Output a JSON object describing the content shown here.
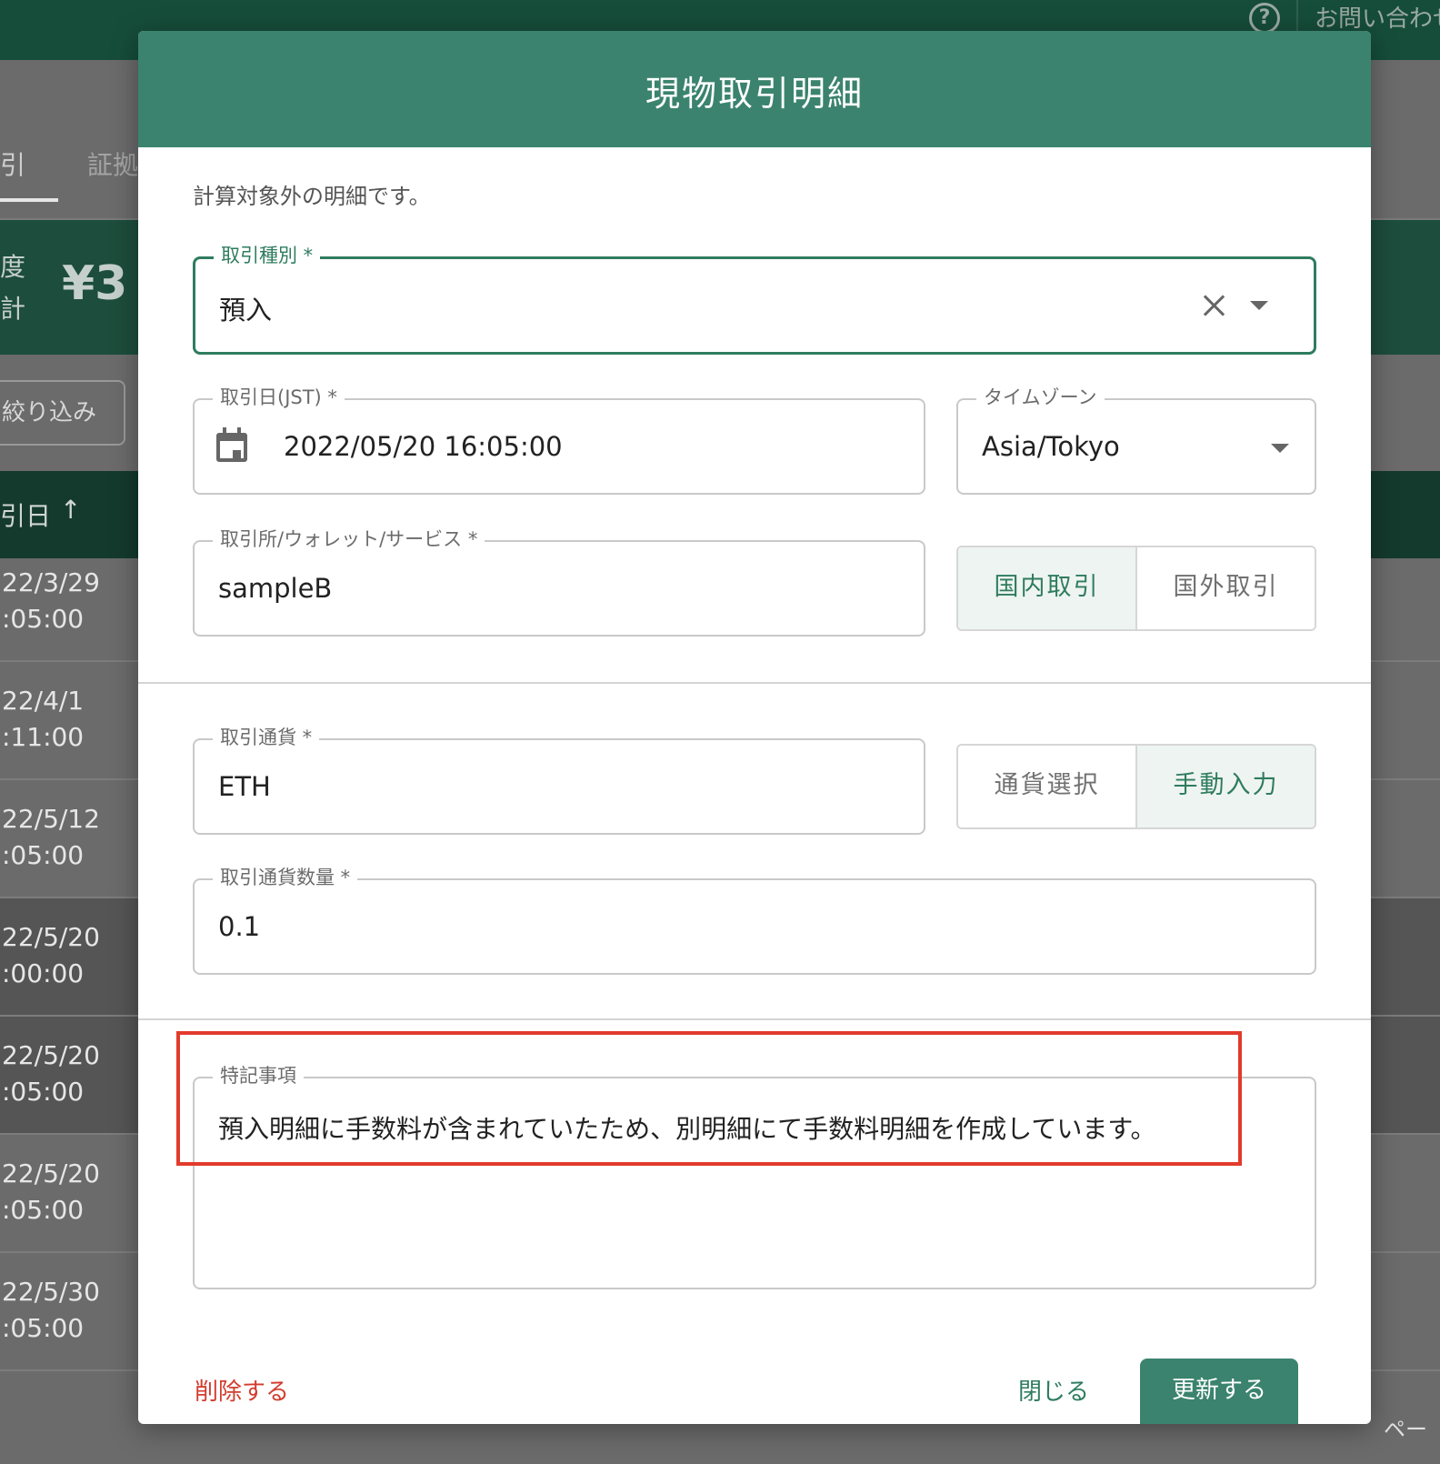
{
  "background": {
    "help_icon_glyph": "?",
    "contact_label": "お問い合わせ",
    "tabs": [
      "引",
      "証拠"
    ],
    "summary": {
      "line1": "度",
      "line2": "計",
      "value": "¥3"
    },
    "filter_button": "絞り込み",
    "table_header": {
      "label": "引日",
      "sort_glyph": "↑"
    },
    "rows": [
      {
        "date": "22/3/29",
        "time": ":05:00"
      },
      {
        "date": "22/4/1",
        "time": ":11:00"
      },
      {
        "date": "22/5/12",
        "time": ":05:00"
      },
      {
        "date": "22/5/20",
        "time": ":00:00"
      },
      {
        "date": "22/5/20",
        "time": ":05:00"
      },
      {
        "date": "22/5/20",
        "time": ":05:00"
      },
      {
        "date": "22/5/30",
        "time": ":05:00"
      }
    ],
    "pagination_label": "ペー"
  },
  "modal": {
    "title": "現物取引明細",
    "note": "計算対象外の明細です。",
    "trade_type": {
      "label": "取引種別 *",
      "value": "預入"
    },
    "trade_date": {
      "label": "取引日(JST) *",
      "value": "2022/05/20 16:05:00"
    },
    "timezone": {
      "label": "タイムゾーン",
      "value": "Asia/Tokyo"
    },
    "exchange": {
      "label": "取引所/ウォレット/サービス *",
      "value": "sampleB"
    },
    "exchange_toggle": {
      "domestic": "国内取引",
      "foreign": "国外取引",
      "selected": "domestic"
    },
    "currency": {
      "label": "取引通貨 *",
      "value": "ETH"
    },
    "currency_toggle": {
      "select": "通貨選択",
      "manual": "手動入力",
      "selected": "manual"
    },
    "quantity": {
      "label": "取引通貨数量 *",
      "value": "0.1"
    },
    "remarks": {
      "label": "特記事項",
      "value": "預入明細に手数料が含まれていたため、別明細にて手数料明細を作成しています。"
    },
    "footer": {
      "delete": "削除する",
      "close": "閉じる",
      "update": "更新する"
    }
  },
  "colors": {
    "brand": "#3b836e",
    "focus": "#2f7c5f",
    "highlight": "#e23b2c",
    "danger": "#d23d2e"
  }
}
